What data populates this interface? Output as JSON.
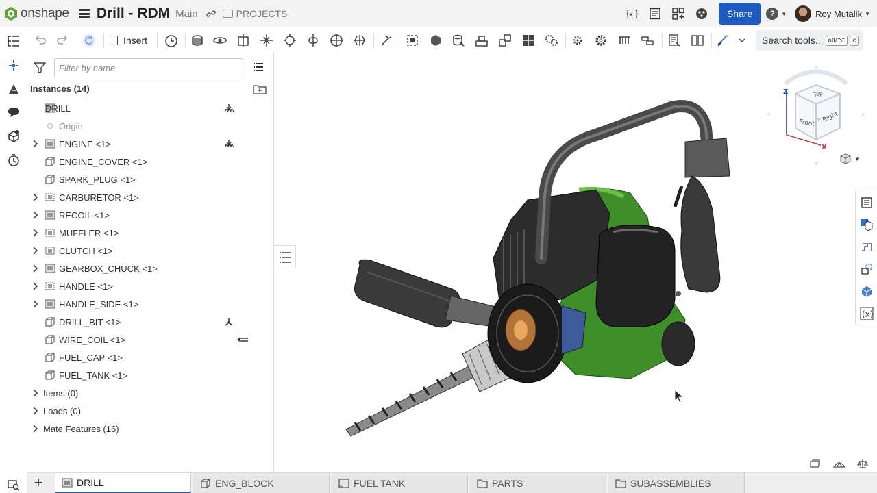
{
  "app": {
    "logo_text": "onshape",
    "doc_title": "Drill - RDM",
    "branch": "Main",
    "projects_label": "PROJECTS",
    "share_label": "Share",
    "user_name": "Roy Mutalik"
  },
  "toolbar": {
    "insert_label": "Insert",
    "search_label": "Search tools...",
    "search_kbd1": "alt/⌥",
    "search_kbd2": "c"
  },
  "panel": {
    "filter_placeholder": "Filter by name",
    "instances_header": "Instances (14)",
    "rows": [
      {
        "label": "DRILL"
      },
      {
        "label": "Origin"
      },
      {
        "label": "ENGINE <1>"
      },
      {
        "label": "ENGINE_COVER <1>"
      },
      {
        "label": "SPARK_PLUG <1>"
      },
      {
        "label": "CARBURETOR <1>"
      },
      {
        "label": "RECOIL <1>"
      },
      {
        "label": "MUFFLER <1>"
      },
      {
        "label": "CLUTCH <1>"
      },
      {
        "label": "GEARBOX_CHUCK <1>"
      },
      {
        "label": "HANDLE <1>"
      },
      {
        "label": "HANDLE_SIDE <1>"
      },
      {
        "label": "DRILL_BIT <1>"
      },
      {
        "label": "WIRE_COIL <1>"
      },
      {
        "label": "FUEL_CAP <1>"
      },
      {
        "label": "FUEL_TANK <1>"
      }
    ],
    "sections": [
      {
        "label": "Items (0)"
      },
      {
        "label": "Loads (0)"
      },
      {
        "label": "Mate Features (16)"
      }
    ]
  },
  "viewcube": {
    "top": "Top",
    "front": "Front",
    "right": "Right",
    "axis_z": "Z",
    "axis_x": "X",
    "axis_y": "Y"
  },
  "tabs": [
    {
      "label": "DRILL"
    },
    {
      "label": "ENG_BLOCK"
    },
    {
      "label": "FUEL TANK"
    },
    {
      "label": "PARTS"
    },
    {
      "label": "SUBASSEMBLIES"
    }
  ],
  "colors": {
    "accent": "#1d5bbf",
    "logo_green": "#5aa832",
    "engine_green": "#3e8e2a"
  }
}
